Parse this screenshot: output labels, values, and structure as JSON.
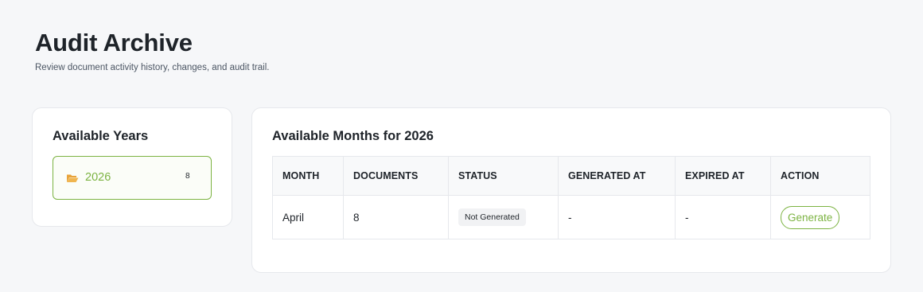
{
  "header": {
    "title": "Audit Archive",
    "subtitle": "Review document activity history, changes, and audit trail."
  },
  "years_panel": {
    "title": "Available Years",
    "items": [
      {
        "year": "2026",
        "count": "8",
        "icon": "folder-open-icon"
      }
    ]
  },
  "months_panel": {
    "title": "Available Months for 2026",
    "columns": [
      "MONTH",
      "DOCUMENTS",
      "STATUS",
      "GENERATED AT",
      "EXPIRED AT",
      "ACTION"
    ],
    "rows": [
      {
        "month": "April",
        "documents": "8",
        "status": "Not Generated",
        "generated_at": "-",
        "expired_at": "-",
        "action": "Generate"
      }
    ]
  },
  "colors": {
    "accent": "#7cb342",
    "folder": "#e8a33a",
    "background": "#f6f7f9"
  }
}
